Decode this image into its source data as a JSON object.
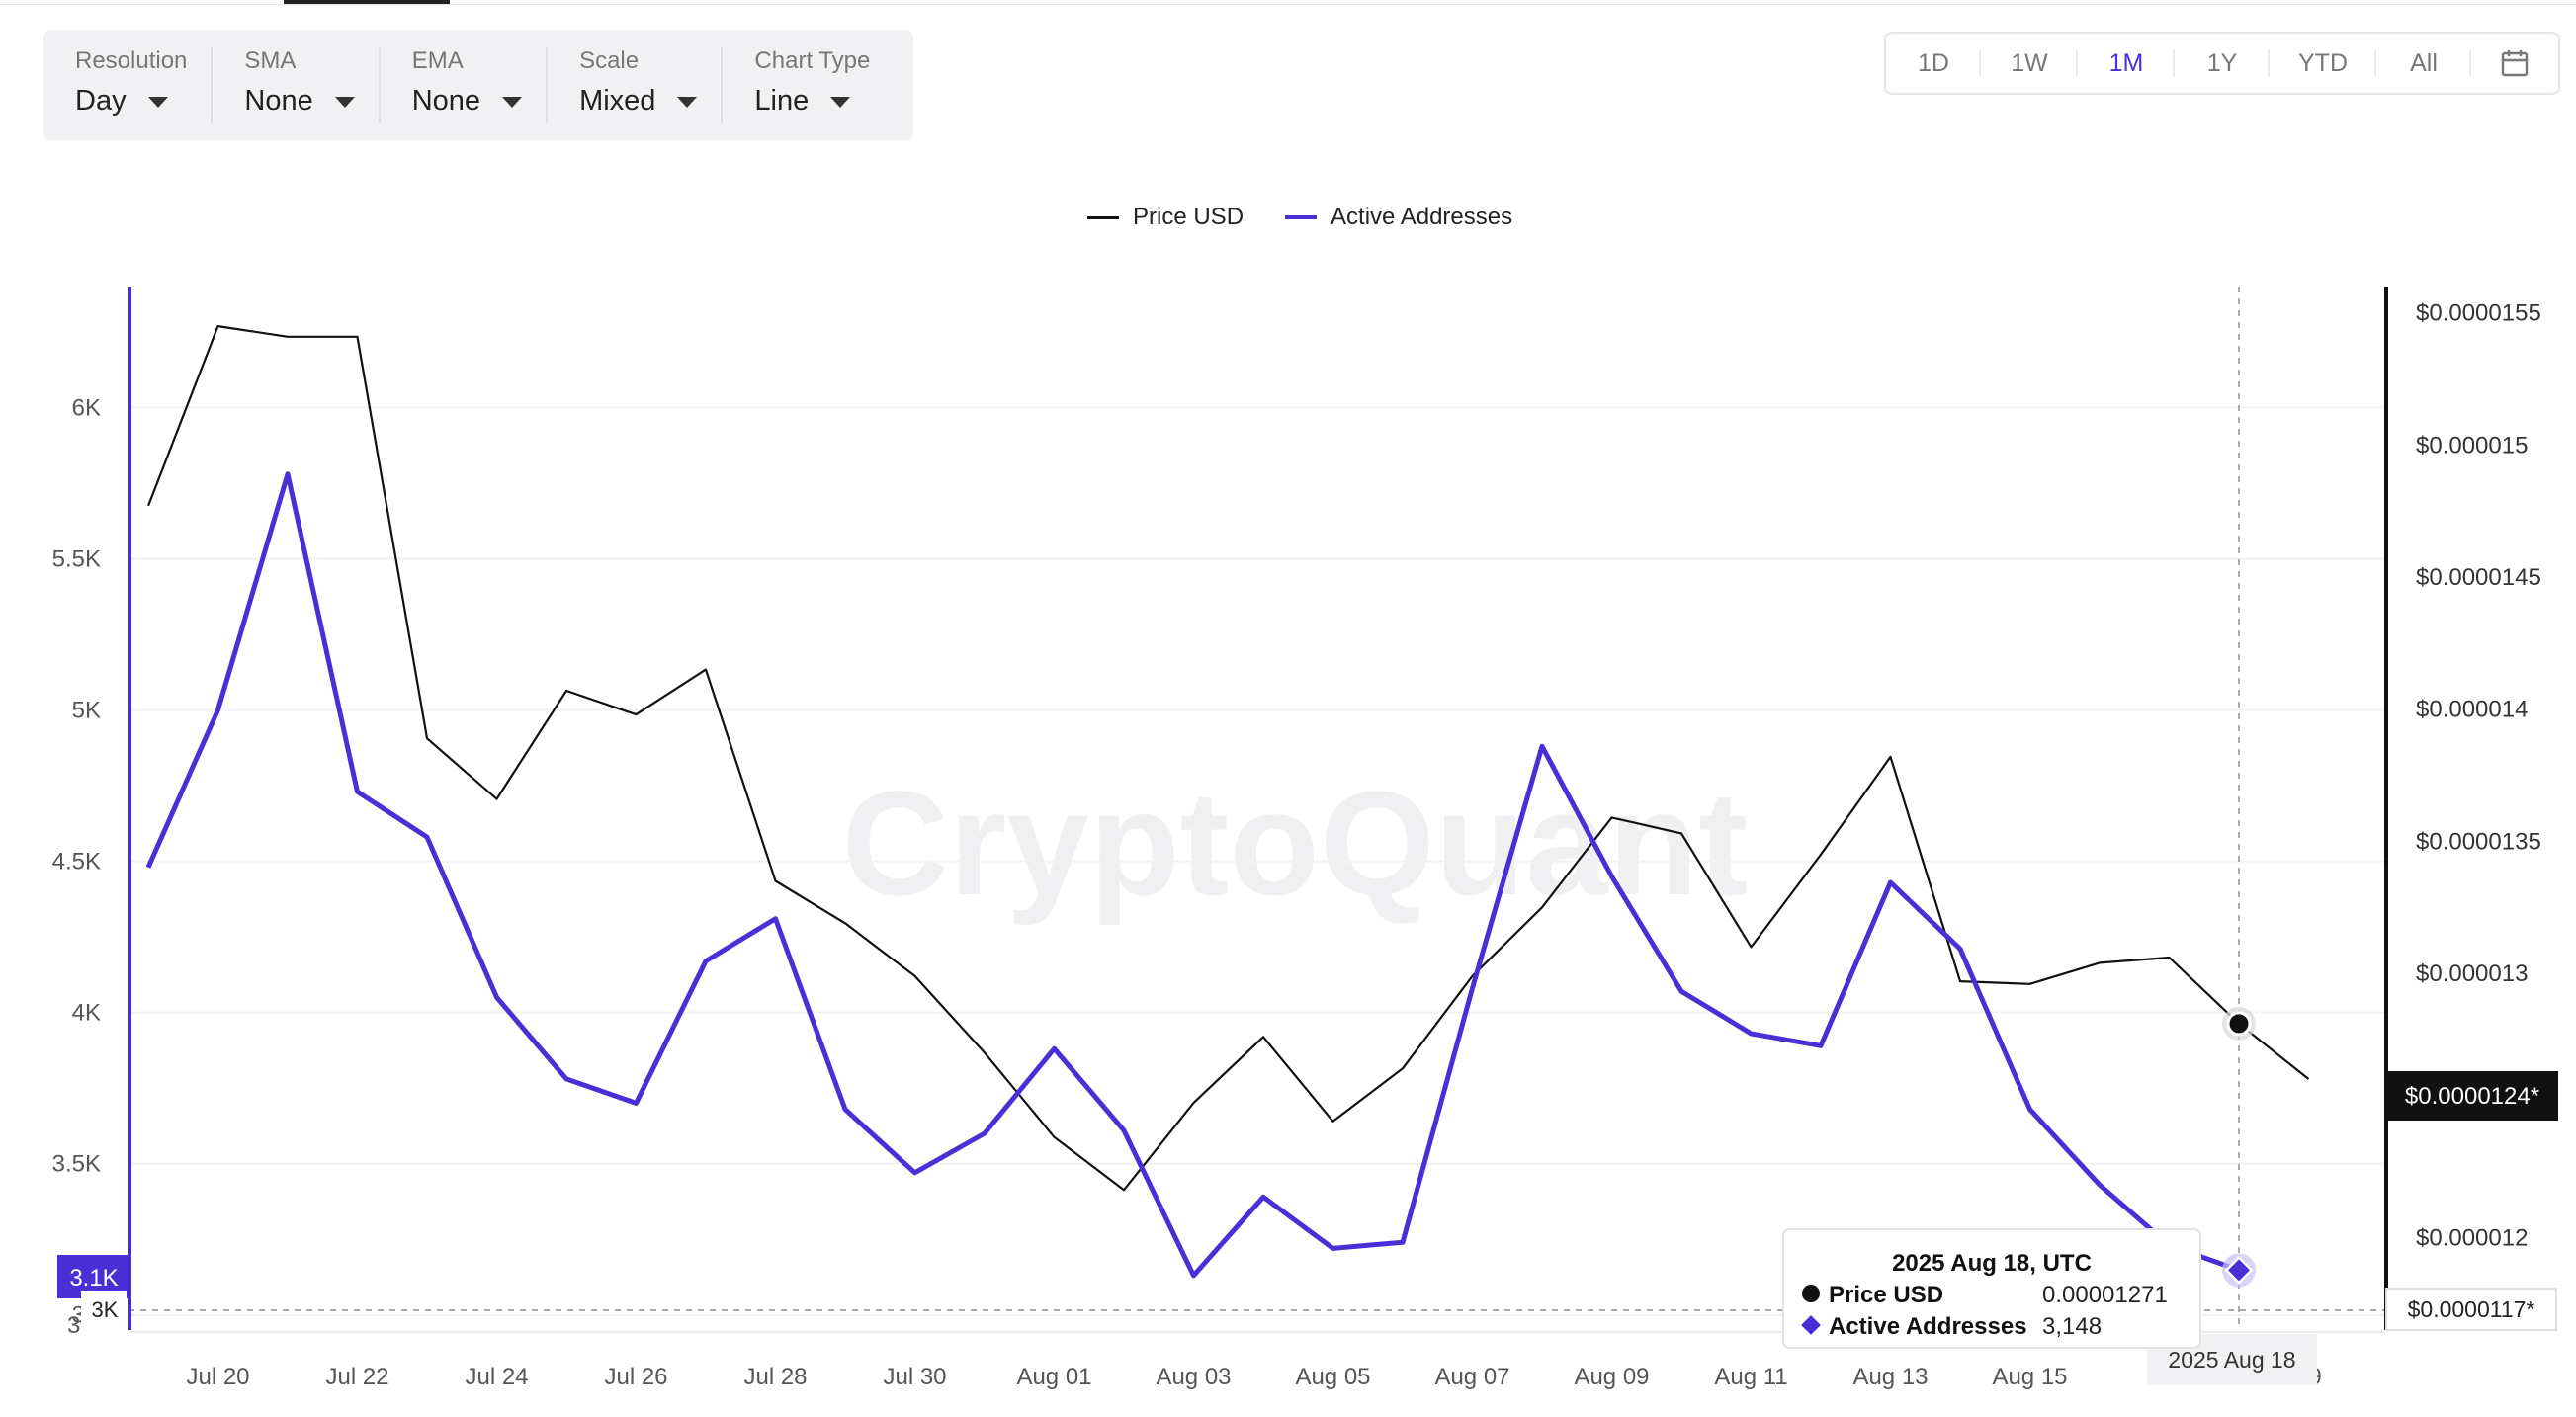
{
  "controls": [
    {
      "label": "Resolution",
      "value": "Day"
    },
    {
      "label": "SMA",
      "value": "None"
    },
    {
      "label": "EMA",
      "value": "None"
    },
    {
      "label": "Scale",
      "value": "Mixed"
    },
    {
      "label": "Chart Type",
      "value": "Line"
    }
  ],
  "ranges": [
    "1D",
    "1W",
    "1M",
    "1Y",
    "YTD",
    "All"
  ],
  "active_range": "1M",
  "icons": {
    "calendar": "calendar-icon"
  },
  "colors": {
    "price": "#111111",
    "active_addresses": "#4b2fd6",
    "accent": "#4b2fd6"
  },
  "watermark": "CryptoQuant",
  "chart_data": {
    "type": "line",
    "x": [
      "Jul 19",
      "Jul 20",
      "Jul 21",
      "Jul 22",
      "Jul 23",
      "Jul 24",
      "Jul 25",
      "Jul 26",
      "Jul 27",
      "Jul 28",
      "Jul 29",
      "Jul 30",
      "Jul 31",
      "Aug 01",
      "Aug 02",
      "Aug 03",
      "Aug 04",
      "Aug 05",
      "Aug 06",
      "Aug 07",
      "Aug 08",
      "Aug 09",
      "Aug 10",
      "Aug 11",
      "Aug 12",
      "Aug 13",
      "Aug 14",
      "Aug 15",
      "Aug 16",
      "Aug 17",
      "Aug 18",
      "Aug 19"
    ],
    "x_tick_labels": [
      "Jul 20",
      "Jul 22",
      "Jul 24",
      "Jul 26",
      "Jul 28",
      "Jul 30",
      "Aug 01",
      "Aug 03",
      "Aug 05",
      "Aug 07",
      "Aug 09",
      "Aug 11",
      "Aug 13",
      "Aug 15",
      "Au",
      "19"
    ],
    "series": [
      {
        "name": "Price USD",
        "axis": "right",
        "values": [
          1.477e-05,
          1.545e-05,
          1.541e-05,
          1.541e-05,
          1.389e-05,
          1.366e-05,
          1.407e-05,
          1.398e-05,
          1.415e-05,
          1.335e-05,
          1.319e-05,
          1.299e-05,
          1.27e-05,
          1.238e-05,
          1.218e-05,
          1.251e-05,
          1.276e-05,
          1.244e-05,
          1.264e-05,
          1.299e-05,
          1.325e-05,
          1.359e-05,
          1.353e-05,
          1.31e-05,
          1.345e-05,
          1.382e-05,
          1.297e-05,
          1.296e-05,
          1.304e-05,
          1.306e-05,
          1.281e-05,
          1.26e-05
        ]
      },
      {
        "name": "Active Addresses",
        "axis": "left",
        "values": [
          4480,
          5000,
          5780,
          4730,
          4580,
          4050,
          3780,
          3700,
          4170,
          4310,
          3680,
          3470,
          3600,
          3880,
          3610,
          3130,
          3390,
          3220,
          3240,
          4080,
          4880,
          4450,
          4070,
          3930,
          3890,
          4430,
          4210,
          3680,
          3430,
          3230,
          3148,
          null
        ]
      }
    ],
    "y_left": {
      "ticks": [
        "3K",
        "3.5K",
        "4K",
        "4.5K",
        "5K",
        "5.5K",
        "6K"
      ],
      "ylim": [
        2950,
        6400
      ]
    },
    "y_right": {
      "ticks": [
        "$0.000012",
        "$0.000013",
        "$0.0000135",
        "$0.000014",
        "$0.0000145",
        "$0.000015",
        "$0.0000155"
      ],
      "ylim": [
        1.165e-05,
        1.56e-05
      ]
    },
    "ref_labels": {
      "left_current": "3.1K",
      "left_partial": "3",
      "right_current": "$0.0000124*",
      "right_lower": "$0.0000117*"
    },
    "tooltip": {
      "date": "2025 Aug 18, UTC",
      "rows": [
        {
          "name": "Price USD",
          "value": "0.00001271"
        },
        {
          "name": "Active Addresses",
          "value": "3,148"
        }
      ]
    },
    "crosshair_label": "2025 Aug 18",
    "legend": "top-center",
    "grid": true
  }
}
